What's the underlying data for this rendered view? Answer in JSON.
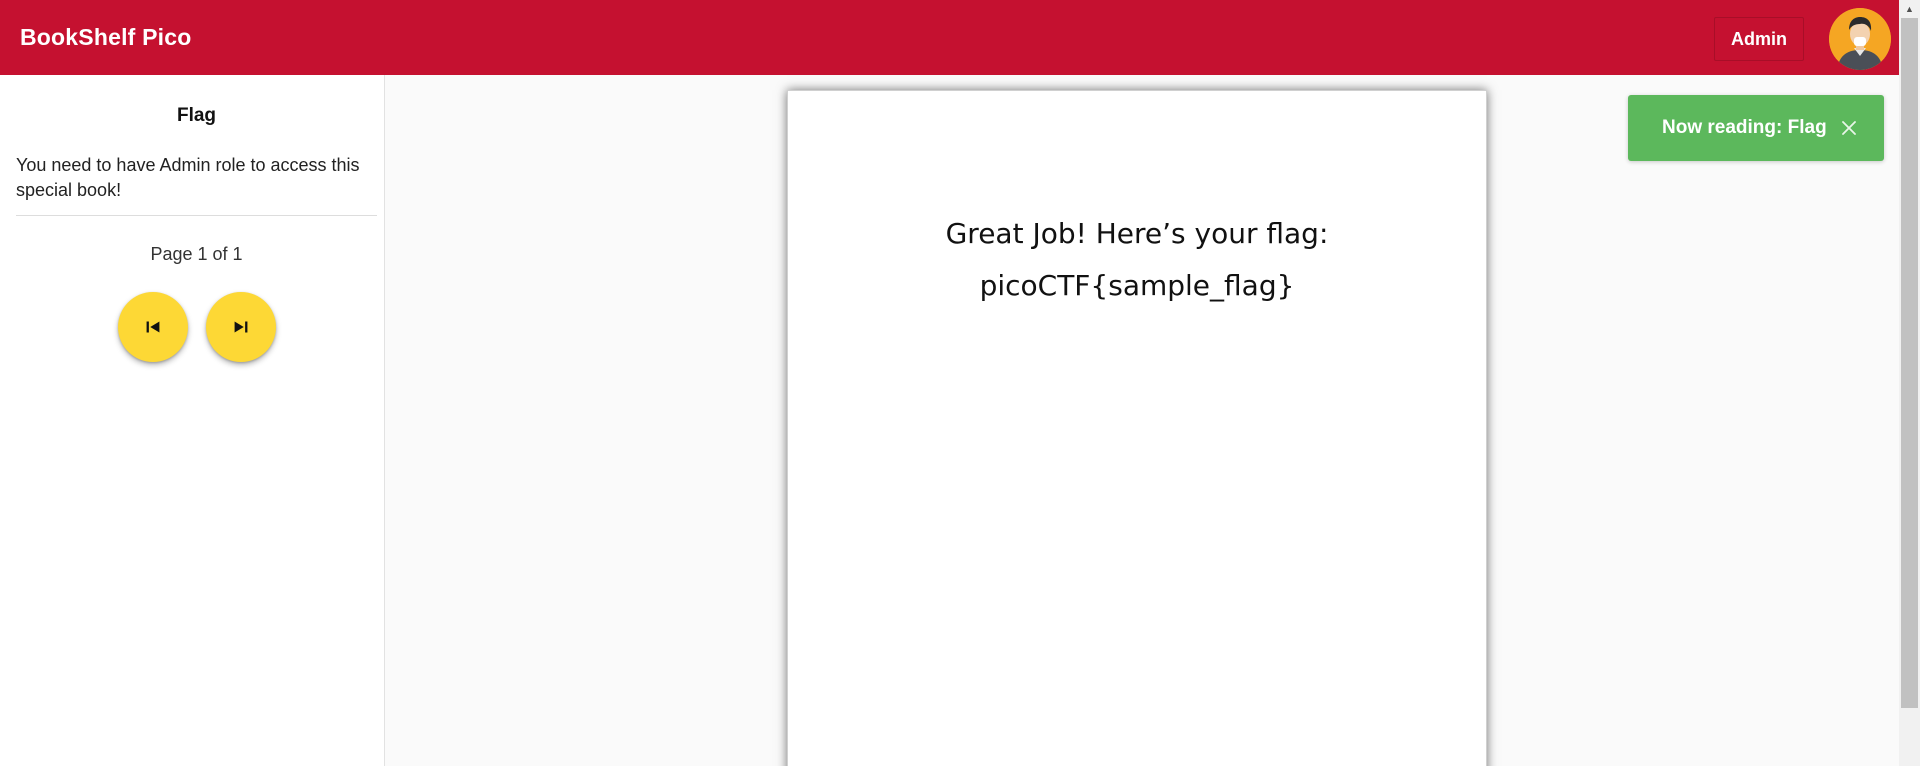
{
  "header": {
    "title": "BookShelf Pico",
    "role_button_label": "Admin",
    "brand_color": "#c51130"
  },
  "sidebar": {
    "book_title": "Flag",
    "book_description": "You need to have Admin role to access this special book!",
    "page_indicator": "Page 1 of 1",
    "prev_button_icon": "skip-previous-icon",
    "next_button_icon": "skip-next-icon",
    "button_color": "#fdd835"
  },
  "page": {
    "line1": "Great Job! Here’s your flag:",
    "line2": "picoCTF{sample_flag}"
  },
  "toast": {
    "message": "Now reading: Flag",
    "close_icon": "close-icon",
    "color": "#5cb85c"
  }
}
